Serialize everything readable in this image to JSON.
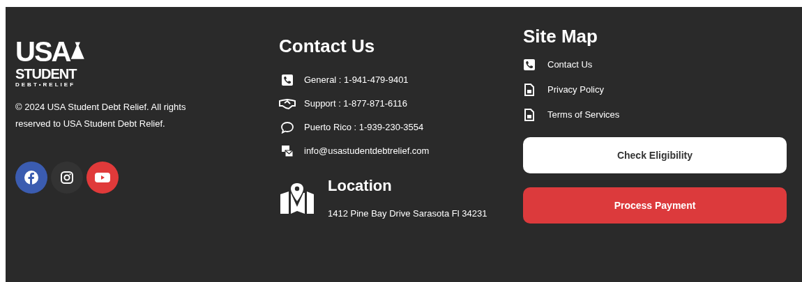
{
  "logo": {
    "line_1": "USA",
    "line_2": "STUDENT",
    "line_3": "DEBT•RELIEF"
  },
  "copyright": "© 2024 USA Student Debt Relief. All rights reserved to USA Student Debt Relief.",
  "social": [
    {
      "kind": "facebook",
      "color": "#3b5cb0"
    },
    {
      "kind": "instagram",
      "color": "#333333"
    },
    {
      "kind": "youtube",
      "color": "#e03a3a"
    }
  ],
  "contact": {
    "title": "Contact Us",
    "items": [
      {
        "kind": "phone",
        "text": "General : 1-941-479-9401"
      },
      {
        "kind": "handshake",
        "text": "Support : 1-877-871-6116"
      },
      {
        "kind": "chat",
        "text": "Puerto Rico : 1-939-230-3554"
      },
      {
        "kind": "email",
        "text": "info@usastudentdebtrelief.com"
      }
    ]
  },
  "location": {
    "title": "Location",
    "address": "1412 Pine Bay Drive Sarasota Fl 34231"
  },
  "site_map": {
    "title": "Site Map",
    "items": [
      {
        "kind": "phone",
        "text": "Contact Us"
      },
      {
        "kind": "document",
        "text": "Privacy Policy"
      },
      {
        "kind": "document",
        "text": "Terms of Services"
      }
    ]
  },
  "buttons": [
    {
      "kind": "secondary",
      "label": "Check Eligibility"
    },
    {
      "kind": "primary",
      "label": "Process Payment"
    }
  ]
}
